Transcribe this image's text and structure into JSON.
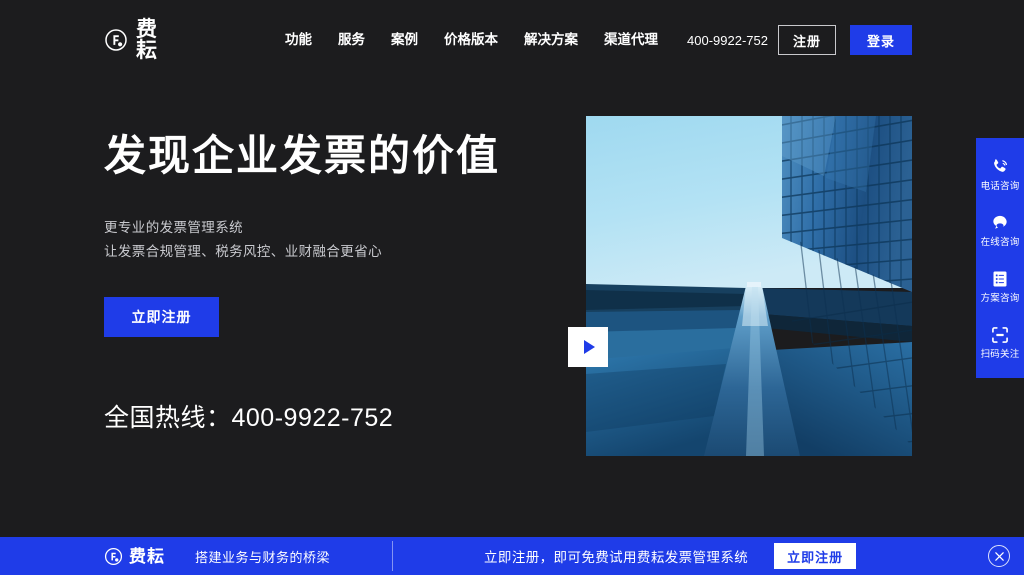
{
  "header": {
    "logo_icon": "feyun-circle-f-logo",
    "brand_name": "费耘",
    "nav": [
      {
        "label": "功能"
      },
      {
        "label": "服务"
      },
      {
        "label": "案例"
      },
      {
        "label": "价格版本"
      },
      {
        "label": "解决方案"
      },
      {
        "label": "渠道代理"
      }
    ],
    "phone": "400-9922-752",
    "register_label": "注册",
    "login_label": "登录"
  },
  "hero": {
    "title": "发现企业发票的价值",
    "subtitle_line1": "更专业的发票管理系统",
    "subtitle_line2": "让发票合规管理、税务风控、业财融合更省心",
    "cta_label": "立即注册",
    "hotline": "全国热线：400-9922-752",
    "play_icon": "play-icon",
    "media_alt": "现代玻璃幕墙摩天大楼仰视图"
  },
  "rail": {
    "items": [
      {
        "icon": "phone-icon",
        "label": "电话咨询"
      },
      {
        "icon": "chat-bubble-icon",
        "label": "在线咨询"
      },
      {
        "icon": "document-list-icon",
        "label": "方案咨询"
      },
      {
        "icon": "qr-scan-icon",
        "label": "扫码关注"
      }
    ]
  },
  "banner": {
    "logo_icon": "feyun-circle-f-logo",
    "brand_name": "费耘",
    "tagline": "搭建业务与财务的桥梁",
    "cta_text": "立即注册，即可免费试用费耘发票管理系统",
    "cta_button": "立即注册",
    "close_icon": "close-icon"
  },
  "colors": {
    "background": "#1c1c1e",
    "accent_blue": "#1f3ce8",
    "text_primary": "#ffffff",
    "text_muted": "#c9cacf",
    "sky_light": "#a9ddf2",
    "glass_blue": "#2f6ea8"
  }
}
